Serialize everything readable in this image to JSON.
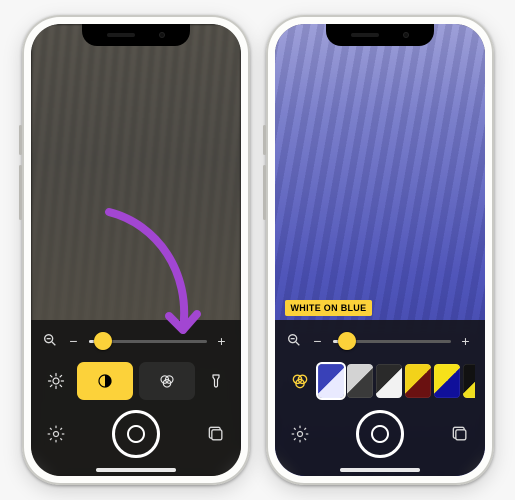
{
  "left": {
    "zoom": {
      "percent": 12
    },
    "modes": {
      "brightness": "brightness",
      "contrast": "contrast",
      "filters": "filters",
      "flashlight": "flashlight",
      "selected": "contrast"
    }
  },
  "right": {
    "zoom": {
      "percent": 12
    },
    "selected_filter_index": 0,
    "filter_label": {
      "text": "WHITE ON BLUE",
      "fg": "#000000",
      "bg": "#fcd23a"
    },
    "filters": [
      {
        "name": "White on Blue",
        "a": "#3941b8",
        "b": "#e9eaff"
      },
      {
        "name": "Grayscale",
        "a": "#d3d3d3",
        "b": "#3a3a3a"
      },
      {
        "name": "Inverted",
        "a": "#2a2a2a",
        "b": "#f2f2f2"
      },
      {
        "name": "Yellow on Black",
        "a": "#f2d21a",
        "b": "#6a1111"
      },
      {
        "name": "Yellow on Blue",
        "a": "#f6e11a",
        "b": "#10109a"
      },
      {
        "name": "Black on Yellow",
        "a": "#111111",
        "b": "#f0df1f"
      }
    ]
  },
  "colors": {
    "accent": "#fcd23a",
    "arrow": "#a246d2"
  }
}
